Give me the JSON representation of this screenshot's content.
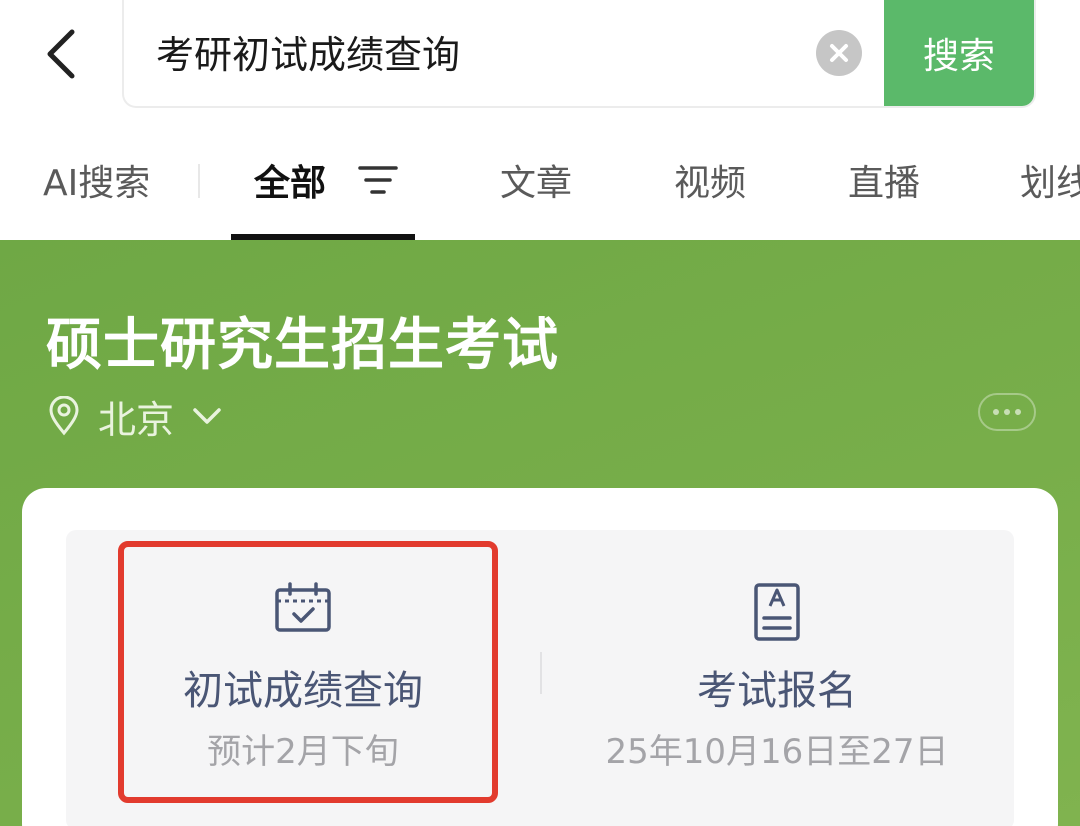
{
  "search": {
    "query": "考研初试成绩查询",
    "button_label": "搜索"
  },
  "tabs": [
    {
      "label": "AI搜索",
      "active": false
    },
    {
      "label": "全部",
      "active": true
    },
    {
      "label": "文章",
      "active": false
    },
    {
      "label": "视频",
      "active": false
    },
    {
      "label": "直播",
      "active": false
    },
    {
      "label": "划线",
      "active": false
    }
  ],
  "hero": {
    "title": "硕士研究生招生考试",
    "location": "北京"
  },
  "services": [
    {
      "icon": "calendar-check-icon",
      "label": "初试成绩查询",
      "sub": "预计2月下旬"
    },
    {
      "icon": "document-a-icon",
      "label": "考试报名",
      "sub": "25年10月16日至27日"
    }
  ],
  "colors": {
    "brand_green": "#5bb96a",
    "hero_green": "#74ab48",
    "highlight_red": "#e23b2e",
    "service_label": "#4a5675"
  }
}
